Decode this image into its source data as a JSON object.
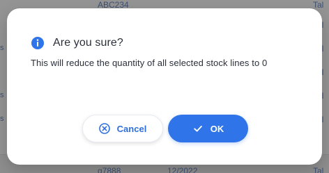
{
  "background": {
    "rows": [
      {
        "left_mark": "",
        "code": "ABC234",
        "date": "",
        "right": "Tal"
      },
      {
        "left_mark": "",
        "code": "",
        "date": "",
        "right": "Tal"
      },
      {
        "left_mark": "s",
        "code": "",
        "date": "",
        "right": "Tal"
      },
      {
        "left_mark": "",
        "code": "",
        "date": "",
        "right": "Tal"
      },
      {
        "left_mark": "s",
        "code": "",
        "date": "",
        "right": "Tal"
      },
      {
        "left_mark": "s",
        "code": "",
        "date": "",
        "right": "Tal"
      },
      {
        "left_mark": "",
        "code": "g7888",
        "date": "12/2022",
        "right": "Tal"
      }
    ]
  },
  "dialog": {
    "icon": "info-icon",
    "title": "Are you sure?",
    "message": "This will reduce the quantity of all selected stock lines to 0",
    "buttons": {
      "cancel": {
        "label": "Cancel",
        "icon": "cancel-circle-icon"
      },
      "ok": {
        "label": "OK",
        "icon": "check-icon"
      }
    }
  },
  "colors": {
    "primary": "#2f74e8",
    "link": "#2f6fdc",
    "text": "#2a2f3a",
    "overlay": "rgba(0,0,0,0.42)"
  }
}
